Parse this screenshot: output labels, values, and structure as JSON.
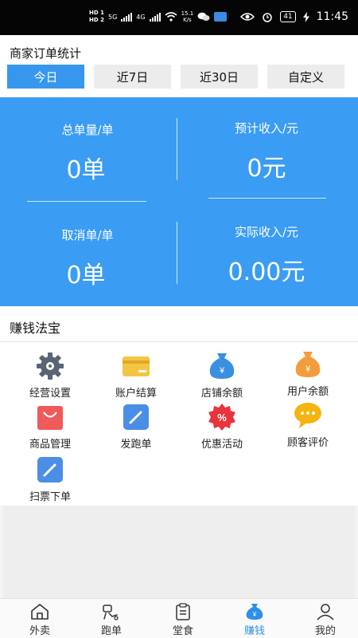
{
  "status_bar": {
    "hd1": "HD 1",
    "hd2": "HD 2",
    "net_5g": "5G",
    "net_4g": "4G",
    "speed_value": "15.1",
    "speed_unit": "K/s",
    "battery": "41",
    "time": "11:45"
  },
  "header": {
    "title": "商家订单统计",
    "tabs": [
      {
        "label": "今日",
        "active": true
      },
      {
        "label": "近7日",
        "active": false
      },
      {
        "label": "近30日",
        "active": false
      },
      {
        "label": "自定义",
        "active": false
      }
    ]
  },
  "stats": {
    "total_orders": {
      "label": "总单量/单",
      "value": "0单"
    },
    "expected_income": {
      "label": "预计收入/元",
      "value": "0元"
    },
    "cancelled_orders": {
      "label": "取消单/单",
      "value": "0单"
    },
    "actual_income": {
      "label": "实际收入/元",
      "value": "0.00元"
    }
  },
  "tools": {
    "title": "赚钱法宝",
    "items": [
      {
        "label": "经营设置",
        "icon": "gear-icon"
      },
      {
        "label": "账户结算",
        "icon": "card-icon"
      },
      {
        "label": "店铺余额",
        "icon": "money-bag-icon"
      },
      {
        "label": "用户余额",
        "icon": "money-bag-icon"
      },
      {
        "label": "商品管理",
        "icon": "shopping-bag-icon"
      },
      {
        "label": "发跑单",
        "icon": "pencil-icon"
      },
      {
        "label": "优惠活动",
        "icon": "discount-badge-icon"
      },
      {
        "label": "顾客评价",
        "icon": "chat-bubble-icon"
      },
      {
        "label": "扫票下单",
        "icon": "pencil-icon"
      }
    ]
  },
  "bottom_nav": {
    "items": [
      {
        "label": "外卖",
        "icon": "house-icon",
        "active": false
      },
      {
        "label": "跑单",
        "icon": "runner-icon",
        "active": false
      },
      {
        "label": "堂食",
        "icon": "clipboard-icon",
        "active": false
      },
      {
        "label": "赚钱",
        "icon": "money-bag-icon",
        "active": true
      },
      {
        "label": "我的",
        "icon": "person-icon",
        "active": false
      }
    ]
  },
  "colors": {
    "accent": "#3a9cf2",
    "active_tab": "#3797ee",
    "gear": "#5a6474",
    "card": "#f4c542",
    "money_blue": "#3a8fe0",
    "money_orange": "#f39c3d",
    "bag_red": "#ef5a5a",
    "pencil_blue": "#4a8ee6",
    "discount_red": "#e8343c",
    "chat_yellow": "#f5b40f"
  }
}
